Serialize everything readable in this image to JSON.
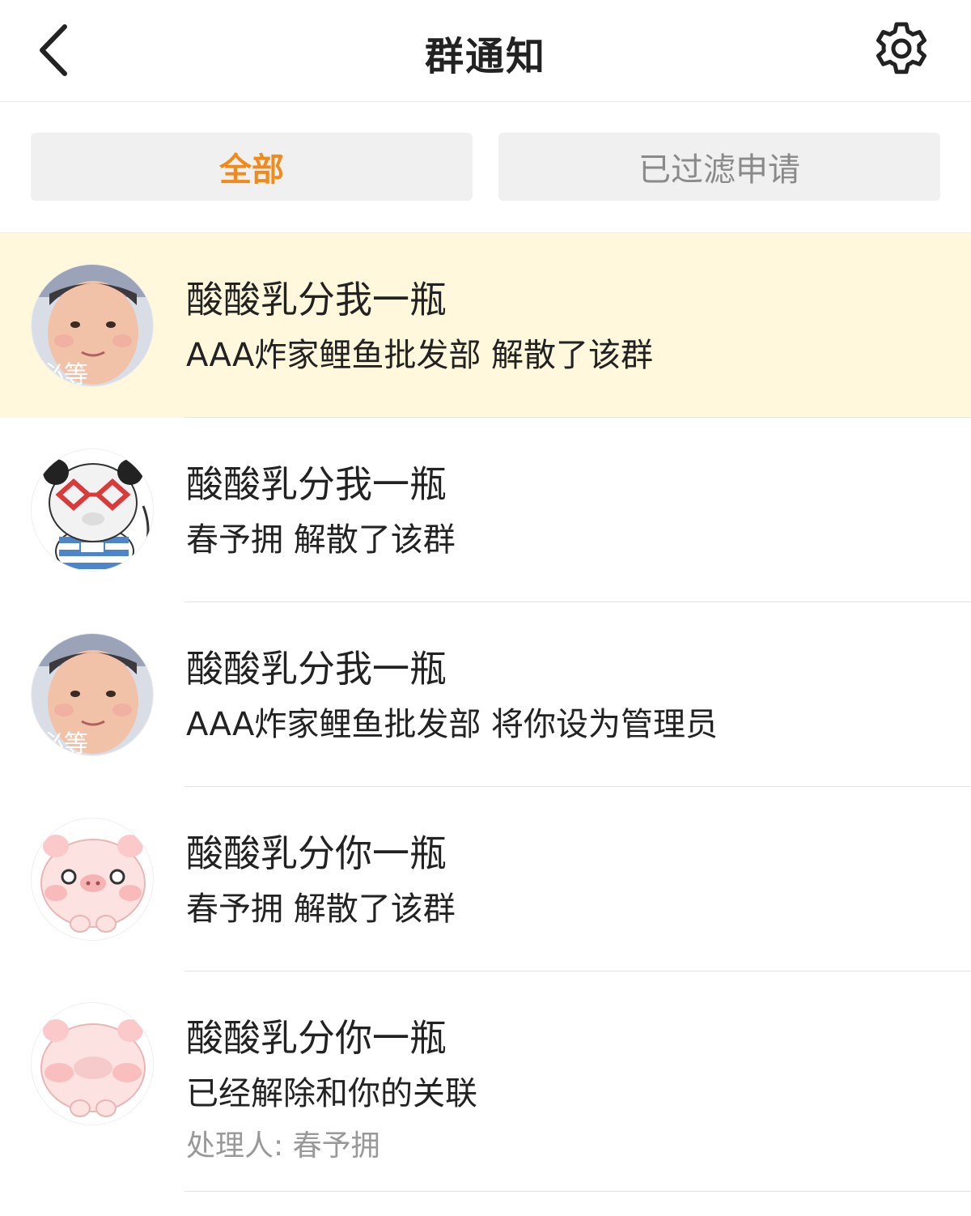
{
  "header": {
    "title": "群通知",
    "back_icon": "chevron-left-icon",
    "settings_icon": "gear-icon"
  },
  "tabs": [
    {
      "label": "全部",
      "active": true,
      "color": "#f08a1c"
    },
    {
      "label": "已过滤申请",
      "active": false,
      "color": "#8a8a8a"
    }
  ],
  "notifications": [
    {
      "name": "酸酸乳分我一瓶",
      "message": "AAA炸家鲤鱼批发部 解散了该群",
      "avatar": "boy-photo-avatar",
      "highlight": true
    },
    {
      "name": "酸酸乳分我一瓶",
      "message": "春予拥 解散了该群",
      "avatar": "panda-avatar",
      "highlight": false
    },
    {
      "name": "酸酸乳分我一瓶",
      "message": "AAA炸家鲤鱼批发部 将你设为管理员",
      "avatar": "boy-photo-avatar",
      "highlight": false
    },
    {
      "name": "酸酸乳分你一瓶",
      "message": "春予拥 解散了该群",
      "avatar": "pig-avatar",
      "highlight": false
    },
    {
      "name": "酸酸乳分你一瓶",
      "message": "已经解除和你的关联",
      "handler": "处理人: 春予拥",
      "avatar": "pig-avatar",
      "highlight": false
    }
  ],
  "colors": {
    "accent": "#f08a1c",
    "highlight_bg": "#fff8dc"
  }
}
